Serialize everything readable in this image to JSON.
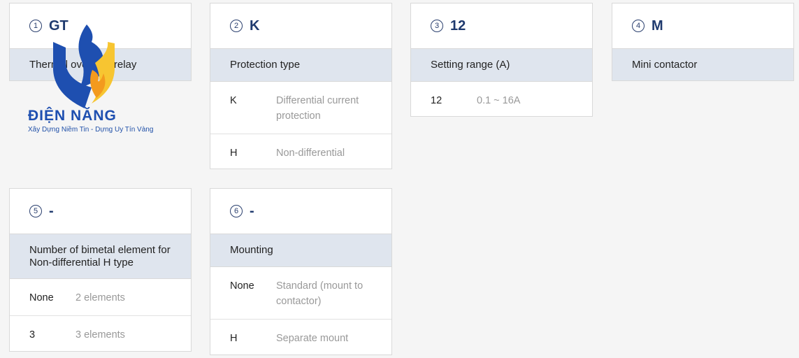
{
  "cards": [
    {
      "num": "1",
      "code": "GT",
      "title": "Thermal overload relay",
      "options": []
    },
    {
      "num": "2",
      "code": "K",
      "title": "Protection type",
      "options": [
        {
          "key": "K",
          "value": "Differential current protection"
        },
        {
          "key": "H",
          "value": "Non-differential"
        }
      ]
    },
    {
      "num": "3",
      "code": "12",
      "title": "Setting range (A)",
      "options": [
        {
          "key": "12",
          "value": "0.1 ~ 16A"
        }
      ]
    },
    {
      "num": "4",
      "code": "M",
      "title": "Mini contactor",
      "options": []
    },
    {
      "num": "5",
      "code": "-",
      "title": "Number of bimetal element for Non-differential H type",
      "options": [
        {
          "key": "None",
          "value": "2 elements"
        },
        {
          "key": "3",
          "value": "3 elements"
        }
      ]
    },
    {
      "num": "6",
      "code": "-",
      "title": "Mounting",
      "options": [
        {
          "key": "None",
          "value": "Standard (mount to contactor)"
        },
        {
          "key": "H",
          "value": "Separate mount"
        }
      ]
    }
  ],
  "logo": {
    "title": "ĐIỆN NĂNG",
    "subtitle": "Xây Dựng Niềm Tin - Dựng Uy Tín Vàng",
    "colors": {
      "blue": "#1e4fb0",
      "orange": "#f39a1e",
      "yellow": "#f7c531"
    }
  }
}
